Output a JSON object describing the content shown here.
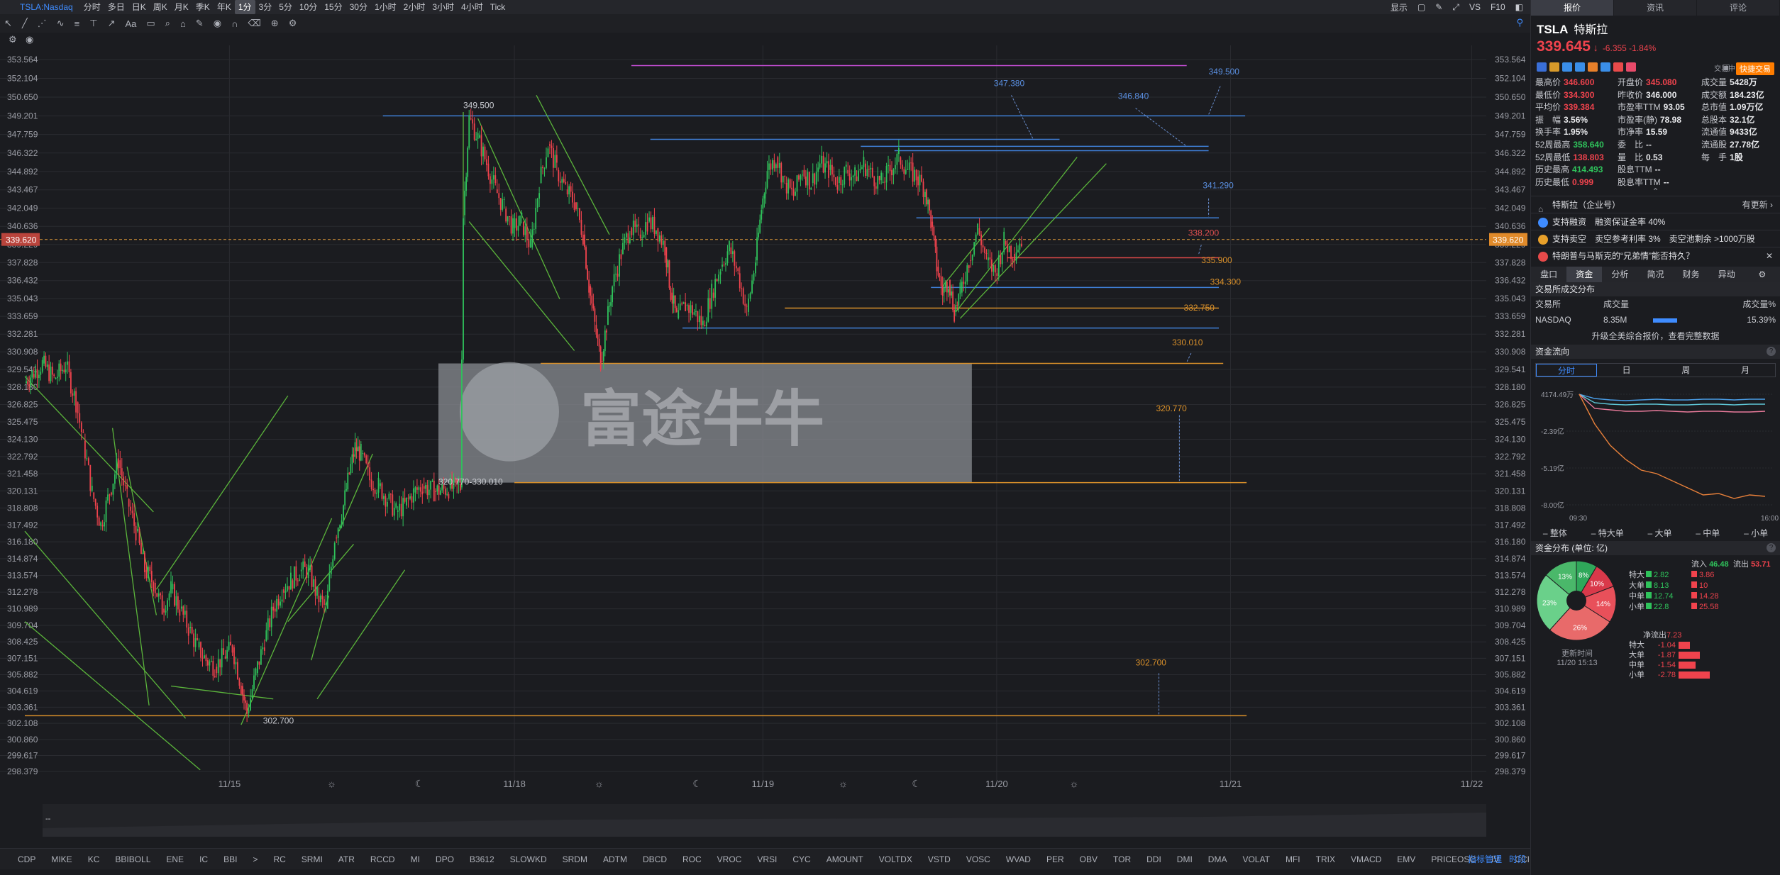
{
  "top": {
    "symbol": "TSLA:Nasdaq",
    "timeframes": [
      "分时",
      "多日",
      "日K",
      "周K",
      "月K",
      "季K",
      "年K",
      "1分",
      "3分",
      "5分",
      "10分",
      "15分",
      "30分",
      "1小时",
      "2小时",
      "3小时",
      "4小时",
      "Tick"
    ],
    "active_timeframe": "1分",
    "display_label": "显示",
    "vs_label": "VS",
    "f10_label": "F10"
  },
  "toolbar": {
    "adjust_label": "前复权"
  },
  "chart_data": {
    "type": "candlestick",
    "symbol": "TSLA",
    "ylim": [
      298.379,
      353.564
    ],
    "y_ticks": [
      353.564,
      352.104,
      350.65,
      349.201,
      347.759,
      346.322,
      344.892,
      343.467,
      342.049,
      340.636,
      339.229,
      337.828,
      336.432,
      335.043,
      333.659,
      332.281,
      330.908,
      329.541,
      328.18,
      326.825,
      325.475,
      324.13,
      322.792,
      321.458,
      320.131,
      318.808,
      317.492,
      316.18,
      314.874,
      313.574,
      312.278,
      310.989,
      309.704,
      308.425,
      307.151,
      305.882,
      304.619,
      303.361,
      302.108,
      300.86,
      299.617,
      298.379
    ],
    "y_tick_labels": [
      "353.564",
      "352.104",
      "350.650",
      "349.201",
      "347.759",
      "346.322",
      "344.892",
      "343.467",
      "342.049",
      "340.636",
      "339.229",
      "337.828",
      "336.432",
      "335.043",
      "333.659",
      "332.281",
      "330.908",
      "329.541",
      "328.180",
      "326.825",
      "325.475",
      "324.130",
      "322.792",
      "321.458",
      "320.131",
      "318.808",
      "317.492",
      "316.180",
      "314.874",
      "313.574",
      "312.278",
      "310.989",
      "309.704",
      "308.425",
      "307.151",
      "305.882",
      "304.619",
      "303.361",
      "302.108",
      "300.860",
      "299.617",
      "298.379"
    ],
    "x_labels": [
      {
        "label": "11/15",
        "t": 0.14
      },
      {
        "label": "11/18",
        "t": 0.335
      },
      {
        "label": "11/19",
        "t": 0.505
      },
      {
        "label": "11/20",
        "t": 0.665
      },
      {
        "label": "11/21",
        "t": 0.825
      },
      {
        "label": "11/22",
        "t": 0.99
      }
    ],
    "last_price_label": "339.620",
    "last_price": 339.62,
    "price_path": [
      [
        0.0,
        328.5
      ],
      [
        0.005,
        329.2
      ],
      [
        0.012,
        330.0
      ],
      [
        0.02,
        328.8
      ],
      [
        0.028,
        329.9
      ],
      [
        0.035,
        327.0
      ],
      [
        0.04,
        324.0
      ],
      [
        0.046,
        320.0
      ],
      [
        0.052,
        317.5
      ],
      [
        0.058,
        320.0
      ],
      [
        0.064,
        322.5
      ],
      [
        0.07,
        319.5
      ],
      [
        0.076,
        317.0
      ],
      [
        0.082,
        314.0
      ],
      [
        0.088,
        313.0
      ],
      [
        0.094,
        311.0
      ],
      [
        0.1,
        312.5
      ],
      [
        0.106,
        311.0
      ],
      [
        0.112,
        309.5
      ],
      [
        0.118,
        308.0
      ],
      [
        0.124,
        307.0
      ],
      [
        0.13,
        306.5
      ],
      [
        0.136,
        307.3
      ],
      [
        0.142,
        308.0
      ],
      [
        0.148,
        305.0
      ],
      [
        0.152,
        302.9
      ],
      [
        0.158,
        306.0
      ],
      [
        0.164,
        308.5
      ],
      [
        0.17,
        311.0
      ],
      [
        0.176,
        312.5
      ],
      [
        0.182,
        313.2
      ],
      [
        0.188,
        313.9
      ],
      [
        0.194,
        314.0
      ],
      [
        0.2,
        312.0
      ],
      [
        0.206,
        311.0
      ],
      [
        0.212,
        316.5
      ],
      [
        0.218,
        319.0
      ],
      [
        0.222,
        321.5
      ],
      [
        0.226,
        323.5
      ],
      [
        0.23,
        323.0
      ],
      [
        0.236,
        321.0
      ],
      [
        0.242,
        320.5
      ],
      [
        0.248,
        319.5
      ],
      [
        0.254,
        318.5
      ],
      [
        0.26,
        319.0
      ],
      [
        0.266,
        320.0
      ],
      [
        0.272,
        320.5
      ],
      [
        0.28,
        320.1
      ],
      [
        0.29,
        320.3
      ],
      [
        0.298,
        320.4
      ],
      [
        0.3,
        341.5
      ],
      [
        0.304,
        349.0
      ],
      [
        0.31,
        347.5
      ],
      [
        0.316,
        345.5
      ],
      [
        0.322,
        343.5
      ],
      [
        0.328,
        342.0
      ],
      [
        0.334,
        340.5
      ],
      [
        0.34,
        341.0
      ],
      [
        0.346,
        339.0
      ],
      [
        0.352,
        344.0
      ],
      [
        0.358,
        347.0
      ],
      [
        0.364,
        345.0
      ],
      [
        0.37,
        343.5
      ],
      [
        0.376,
        342.5
      ],
      [
        0.382,
        340.0
      ],
      [
        0.386,
        336.0
      ],
      [
        0.39,
        333.0
      ],
      [
        0.394,
        330.2
      ],
      [
        0.398,
        333.0
      ],
      [
        0.402,
        336.0
      ],
      [
        0.408,
        338.5
      ],
      [
        0.414,
        340.5
      ],
      [
        0.42,
        340.0
      ],
      [
        0.426,
        341.0
      ],
      [
        0.432,
        340.5
      ],
      [
        0.438,
        339.0
      ],
      [
        0.442,
        335.5
      ],
      [
        0.446,
        333.5
      ],
      [
        0.452,
        334.5
      ],
      [
        0.458,
        334.0
      ],
      [
        0.464,
        333.0
      ],
      [
        0.47,
        335.5
      ],
      [
        0.476,
        337.5
      ],
      [
        0.482,
        339.0
      ],
      [
        0.488,
        337.0
      ],
      [
        0.494,
        334.0
      ],
      [
        0.5,
        338.0
      ],
      [
        0.504,
        342.0
      ],
      [
        0.508,
        345.0
      ],
      [
        0.514,
        346.0
      ],
      [
        0.52,
        344.0
      ],
      [
        0.526,
        343.0
      ],
      [
        0.532,
        345.0
      ],
      [
        0.538,
        344.0
      ],
      [
        0.544,
        345.5
      ],
      [
        0.55,
        345.0
      ],
      [
        0.556,
        344.0
      ],
      [
        0.562,
        345.0
      ],
      [
        0.568,
        344.5
      ],
      [
        0.574,
        345.5
      ],
      [
        0.58,
        344.5
      ],
      [
        0.586,
        344.0
      ],
      [
        0.592,
        345.0
      ],
      [
        0.598,
        346.0
      ],
      [
        0.604,
        345.0
      ],
      [
        0.61,
        344.5
      ],
      [
        0.616,
        343.5
      ],
      [
        0.62,
        341.0
      ],
      [
        0.624,
        337.5
      ],
      [
        0.628,
        335.5
      ],
      [
        0.632,
        336.5
      ],
      [
        0.636,
        334.0
      ],
      [
        0.64,
        335.5
      ],
      [
        0.646,
        338.0
      ],
      [
        0.652,
        340.5
      ],
      [
        0.658,
        338.0
      ],
      [
        0.664,
        337.0
      ],
      [
        0.67,
        339.5
      ],
      [
        0.676,
        338.5
      ],
      [
        0.682,
        339.62
      ]
    ],
    "hlines": [
      {
        "price": 353.1,
        "color": "#c84fd8",
        "t0": 0.415,
        "t1": 0.795,
        "label": ""
      },
      {
        "price": 349.201,
        "color": "#3f7fd6",
        "t0": 0.245,
        "t1": 0.835,
        "label": "349.500"
      },
      {
        "price": 347.38,
        "color": "#3f7fd6",
        "t0": 0.428,
        "t1": 0.708,
        "label": "347.380"
      },
      {
        "price": 346.84,
        "color": "#3f7fd6",
        "t0": 0.572,
        "t1": 0.81,
        "label": "346.840"
      },
      {
        "price": 346.5,
        "color": "#3f7fd6",
        "t0": 0.595,
        "t1": 0.81,
        "label": ""
      },
      {
        "price": 341.29,
        "color": "#3f7fd6",
        "t0": 0.61,
        "t1": 0.817,
        "label": "341.290"
      },
      {
        "price": 338.2,
        "color": "#d94848",
        "t0": 0.672,
        "t1": 0.817,
        "label": "338.200"
      },
      {
        "price": 335.9,
        "color": "#3f7fd6",
        "t0": 0.62,
        "t1": 0.817,
        "label": "335.900"
      },
      {
        "price": 334.3,
        "color": "#d9902a",
        "t0": 0.52,
        "t1": 0.817,
        "label": "334.300"
      },
      {
        "price": 332.75,
        "color": "#3f7fd6",
        "t0": 0.45,
        "t1": 0.817,
        "label": "332.750"
      },
      {
        "price": 330.01,
        "color": "#d9902a",
        "t0": 0.353,
        "t1": 0.82,
        "label": "330.010"
      },
      {
        "price": 320.77,
        "color": "#d9902a",
        "t0": 0.335,
        "t1": 0.836,
        "label": "320.770"
      },
      {
        "price": 302.7,
        "color": "#d9902a",
        "t0": 0.0,
        "t1": 0.836,
        "label": "302.700"
      }
    ],
    "annotations": [
      {
        "text": "349.500",
        "t": 0.3,
        "price": 349.8
      },
      {
        "text": "302.700",
        "t": 0.163,
        "price": 302.1
      },
      {
        "text": "320.770-330.010",
        "t": 0.283,
        "price": 320.6
      },
      {
        "text": "347.380",
        "t": 0.663,
        "price": 351.5
      },
      {
        "text": "346.840",
        "t": 0.748,
        "price": 350.5
      },
      {
        "text": "349.500",
        "t": 0.81,
        "price": 352.4
      },
      {
        "text": "341.290",
        "t": 0.806,
        "price": 343.6
      },
      {
        "text": "338.200",
        "t": 0.796,
        "price": 339.9
      },
      {
        "text": "335.900",
        "t": 0.805,
        "price": 337.8
      },
      {
        "text": "334.300",
        "t": 0.811,
        "price": 336.1
      },
      {
        "text": "332.750",
        "t": 0.793,
        "price": 334.1
      },
      {
        "text": "330.010",
        "t": 0.785,
        "price": 331.4
      },
      {
        "text": "320.770",
        "t": 0.774,
        "price": 326.3
      },
      {
        "text": "302.700",
        "t": 0.76,
        "price": 306.6
      }
    ],
    "zone": {
      "t0": 0.283,
      "t1": 0.648,
      "p0": 320.77,
      "p1": 330.01
    },
    "watermark": "富途牛牛",
    "colors": {
      "up": "#2fc25b",
      "down": "#f0434d",
      "trend": "#5bb53b",
      "grid": "#2a2b30"
    }
  },
  "indicators": {
    "items": [
      "CDP",
      "MIKE",
      "KC",
      "BBIBOLL",
      "ENE",
      "IC",
      "BBI",
      ">",
      "RC",
      "SRMI",
      "ATR",
      "RCCD",
      "MI",
      "DPO",
      "B3612",
      "SLOWKD",
      "SRDM",
      "ADTM",
      "DBCD",
      "ROC",
      "VROC",
      "VRSI",
      "CYC",
      "AMOUNT",
      "VOLTDX",
      "VSTD",
      "VOSC",
      "WVAD",
      "PER",
      "OBV",
      "TOR",
      "DDI",
      "DMI",
      "DMA",
      "VOLAT",
      "MFI",
      "TRIX",
      "VMACD",
      "EMV",
      "PRICEOSC",
      "IV",
      "CCI",
      "MTM",
      ">"
    ],
    "manage_label": "指标管理",
    "last_label": "时段"
  },
  "panel": {
    "tabs": [
      "报价",
      "资讯",
      "评论"
    ],
    "code": "TSLA",
    "name": "特斯拉",
    "price": "339.645",
    "change": "-6.355 -1.84%",
    "time": "交易中 11/20 15:13",
    "trade_btn": "快捷交易",
    "stats": [
      [
        "最高价",
        "346.600",
        "red"
      ],
      [
        "开盘价",
        "345.080",
        "red"
      ],
      [
        "成交量",
        "5428万",
        "wht"
      ],
      [
        "最低价",
        "334.300",
        "red"
      ],
      [
        "昨收价",
        "346.000",
        "wht"
      ],
      [
        "成交额",
        "184.23亿",
        "wht"
      ],
      [
        "平均价",
        "339.384",
        "red"
      ],
      [
        "市盈率TTM",
        "93.05",
        "wht"
      ],
      [
        "总市值",
        "1.09万亿",
        "wht"
      ],
      [
        "振　幅",
        "3.56%",
        "wht"
      ],
      [
        "市盈率(静)",
        "78.98",
        "wht"
      ],
      [
        "总股本",
        "32.1亿",
        "wht"
      ],
      [
        "换手率",
        "1.95%",
        "wht"
      ],
      [
        "市净率",
        "15.59",
        "wht"
      ],
      [
        "流通值",
        "9433亿",
        "wht"
      ],
      [
        "52周最高",
        "358.640",
        "green"
      ],
      [
        "委　比",
        "--",
        "wht"
      ],
      [
        "流通股",
        "27.78亿",
        "wht"
      ],
      [
        "52周最低",
        "138.803",
        "red"
      ],
      [
        "量　比",
        "0.53",
        "wht"
      ],
      [
        "每　手",
        "1股",
        "wht"
      ],
      [
        "历史最高",
        "414.493",
        "green"
      ],
      [
        "股息TTM",
        "--",
        "wht"
      ],
      [
        "",
        "",
        " "
      ],
      [
        "历史最低",
        "0.999",
        "red"
      ],
      [
        "股息率TTM",
        "--",
        "wht"
      ],
      [
        "",
        "",
        " "
      ]
    ],
    "rows": [
      {
        "text": "特斯拉（企业号）",
        "right": "有更新 ›"
      },
      {
        "text": "支持融资　融资保证金率 40%",
        "right": ""
      },
      {
        "text": "支持卖空　卖空参考利率 3%　卖空池剩余 >1000万股",
        "right": ""
      },
      {
        "text": "特朗普与马斯克的“兄弟情”能否持久？",
        "right": "✕"
      }
    ],
    "subtabs": [
      "盘口",
      "资金",
      "分析",
      "简况",
      "财务",
      "异动"
    ],
    "active_subtab": "资金",
    "exchange": {
      "title": "交易所成交分布",
      "headers": [
        "交易所",
        "成交量",
        "",
        "成交量%"
      ],
      "row": [
        "NASDAQ",
        "8.35M",
        "",
        "15.39%"
      ],
      "note": "升级全美综合报价，查看完整数据"
    },
    "flow": {
      "title": "资金流向",
      "tabs": [
        "分时",
        "日",
        "周",
        "月"
      ],
      "active": "分时",
      "y_labels": [
        "4174.49万",
        "-2.39亿",
        "-5.19亿",
        "-8.00亿"
      ],
      "x_labels": [
        "09:30",
        "16:00"
      ],
      "legend": [
        "整体",
        "特大单",
        "大单",
        "中单",
        "小单"
      ]
    },
    "dist": {
      "title": "资金分布 (单位: 亿)",
      "in_label": "流入",
      "in_val": "46.48",
      "out_label": "流出",
      "out_val": "53.71",
      "rows": [
        [
          "特大",
          "2.82",
          "3.86"
        ],
        [
          "大单",
          "8.13",
          "10"
        ],
        [
          "中单",
          "12.74",
          "14.28"
        ],
        [
          "小单",
          "22.8",
          "25.58"
        ]
      ],
      "pie": [
        [
          "8%",
          "#2fc25b",
          8
        ],
        [
          "10%",
          "#f0434d",
          10
        ],
        [
          "14%",
          "#f0434d",
          14
        ],
        [
          "26%",
          "#f0434d",
          26
        ],
        [
          "23%",
          "#2fc25b",
          23
        ],
        [
          "13%",
          "#2fc25b",
          13
        ]
      ],
      "update_label": "更新时间",
      "update_time": "11/20 15:13",
      "net_label": "净流出",
      "net_val": "7.23",
      "net_rows": [
        [
          "特大",
          "-1.04"
        ],
        [
          "大单",
          "-1.87"
        ],
        [
          "中单",
          "-1.54"
        ],
        [
          "小单",
          "-2.78"
        ]
      ]
    }
  }
}
